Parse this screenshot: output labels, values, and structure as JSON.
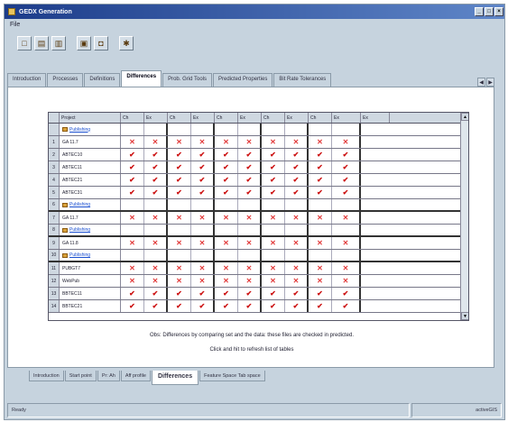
{
  "window": {
    "title": "GEDX Generation",
    "controls": [
      "_",
      "□",
      "×"
    ]
  },
  "menubar": {
    "items": [
      "File"
    ]
  },
  "toolbar": {
    "buttons": [
      "new-icon",
      "open-icon",
      "folder-icon",
      "save-icon",
      "print-icon",
      "run-icon"
    ]
  },
  "tabs_top": {
    "items": [
      "Introduction",
      "Processes",
      "Definitions",
      "Differences",
      "Prob. Grid Tools",
      "Predicted Properties",
      "Bit Rate Tolerances"
    ],
    "active_index": 3
  },
  "grid": {
    "columns": [
      "Project",
      "Ch",
      "Ex",
      "Ch",
      "Ex",
      "Ch",
      "Ex",
      "Ch",
      "Ex",
      "Ch",
      "Ex",
      "Ex"
    ],
    "rows": [
      {
        "num": "",
        "name": "",
        "link": "Publishing",
        "icon": true,
        "cells": [],
        "thick": false
      },
      {
        "num": "1",
        "name": "GA 11.7",
        "link": "",
        "icon": false,
        "cells": [
          "x",
          "x",
          "x",
          "x",
          "x",
          "x",
          "x",
          "x",
          "x",
          "x"
        ],
        "thick": false
      },
      {
        "num": "2",
        "name": "ABTEC10",
        "link": "",
        "icon": false,
        "cells": [
          "v",
          "v",
          "v",
          "v",
          "v",
          "v",
          "v",
          "v",
          "v",
          "v"
        ],
        "thick": false
      },
      {
        "num": "3",
        "name": "ABTEC11",
        "link": "",
        "icon": false,
        "cells": [
          "v",
          "v",
          "v",
          "v",
          "v",
          "v",
          "v",
          "v",
          "v",
          "v"
        ],
        "thick": false
      },
      {
        "num": "4",
        "name": "ABTEC21",
        "link": "",
        "icon": false,
        "cells": [
          "v",
          "v",
          "v",
          "v",
          "v",
          "v",
          "v",
          "v",
          "v",
          "v"
        ],
        "thick": false
      },
      {
        "num": "5",
        "name": "ABTEC31",
        "link": "",
        "icon": false,
        "cells": [
          "v",
          "v",
          "v",
          "v",
          "v",
          "v",
          "v",
          "v",
          "v",
          "v"
        ],
        "thick": false
      },
      {
        "num": "6",
        "name": "",
        "link": "Publishing",
        "icon": true,
        "cells": [],
        "thick": true
      },
      {
        "num": "7",
        "name": "GA 11.7",
        "link": "",
        "icon": false,
        "cells": [
          "x",
          "x",
          "x",
          "x",
          "x",
          "x",
          "x",
          "x",
          "x",
          "x"
        ],
        "thick": false
      },
      {
        "num": "8",
        "name": "",
        "link": "Publishing",
        "icon": true,
        "cells": [],
        "thick": true
      },
      {
        "num": "9",
        "name": "GA 11.8",
        "link": "",
        "icon": false,
        "cells": [
          "x",
          "x",
          "x",
          "x",
          "x",
          "x",
          "x",
          "x",
          "x",
          "x"
        ],
        "thick": false
      },
      {
        "num": "10",
        "name": "",
        "link": "Publishing",
        "icon": true,
        "cells": [],
        "thick": true
      },
      {
        "num": "11",
        "name": "PUBGT7",
        "link": "",
        "icon": false,
        "cells": [
          "x",
          "x",
          "x",
          "x",
          "x",
          "x",
          "x",
          "x",
          "x",
          "x"
        ],
        "thick": false
      },
      {
        "num": "12",
        "name": "WebPub",
        "link": "",
        "icon": false,
        "cells": [
          "x",
          "x",
          "x",
          "x",
          "x",
          "x",
          "x",
          "x",
          "x",
          "x"
        ],
        "thick": false
      },
      {
        "num": "13",
        "name": "BBTEC11",
        "link": "",
        "icon": false,
        "cells": [
          "v",
          "v",
          "v",
          "v",
          "v",
          "v",
          "v",
          "v",
          "v",
          "v"
        ],
        "thick": false
      },
      {
        "num": "14",
        "name": "BBTEC21",
        "link": "",
        "icon": false,
        "cells": [
          "v",
          "v",
          "v",
          "v",
          "v",
          "v",
          "v",
          "v",
          "v",
          "v"
        ],
        "thick": false
      }
    ],
    "scroll_up": "▲",
    "scroll_down": "▼"
  },
  "notes": {
    "line1": "Obs: Differences by comparing set and the data: these files are checked in predicted.",
    "line2": "Click and hit to refresh list of tables"
  },
  "tabs_bottom": {
    "items": [
      "Introduction",
      "Start point",
      "Pr: Ah",
      "Aff profile",
      "Differences",
      "Feature Space Tab space"
    ],
    "active_index": 4
  },
  "statusbar": {
    "left": "Ready",
    "right": "activeGIS"
  },
  "colors": {
    "title_bar": "#1c3c8a",
    "mark_x": "#e23b3b",
    "mark_v": "#cc1111"
  }
}
